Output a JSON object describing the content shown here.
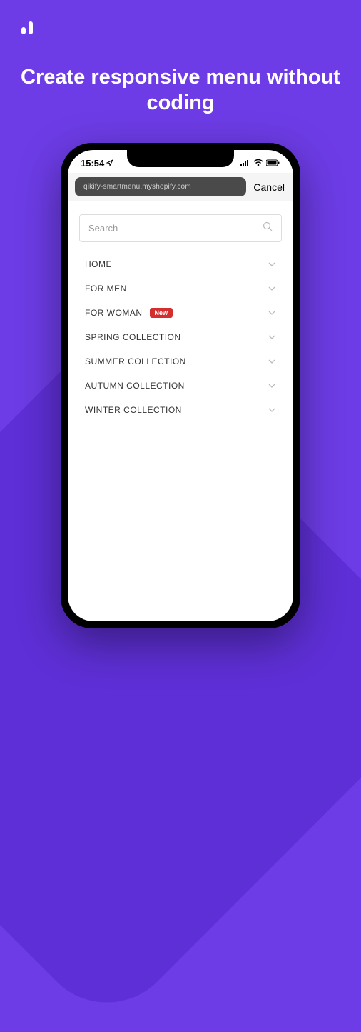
{
  "headline": "Create responsive menu without coding",
  "status": {
    "time": "15:54"
  },
  "browser": {
    "url": "qikify-smartmenu.myshopify.com",
    "cancel": "Cancel"
  },
  "search": {
    "placeholder": "Search"
  },
  "menu": {
    "items": [
      {
        "label": "HOME",
        "badge": null
      },
      {
        "label": "FOR MEN",
        "badge": null
      },
      {
        "label": "FOR WOMAN",
        "badge": "New"
      },
      {
        "label": "SPRING COLLECTION",
        "badge": null
      },
      {
        "label": "SUMMER COLLECTION",
        "badge": null
      },
      {
        "label": "AUTUMN COLLECTION",
        "badge": null
      },
      {
        "label": "WINTER COLLECTION",
        "badge": null
      }
    ]
  }
}
